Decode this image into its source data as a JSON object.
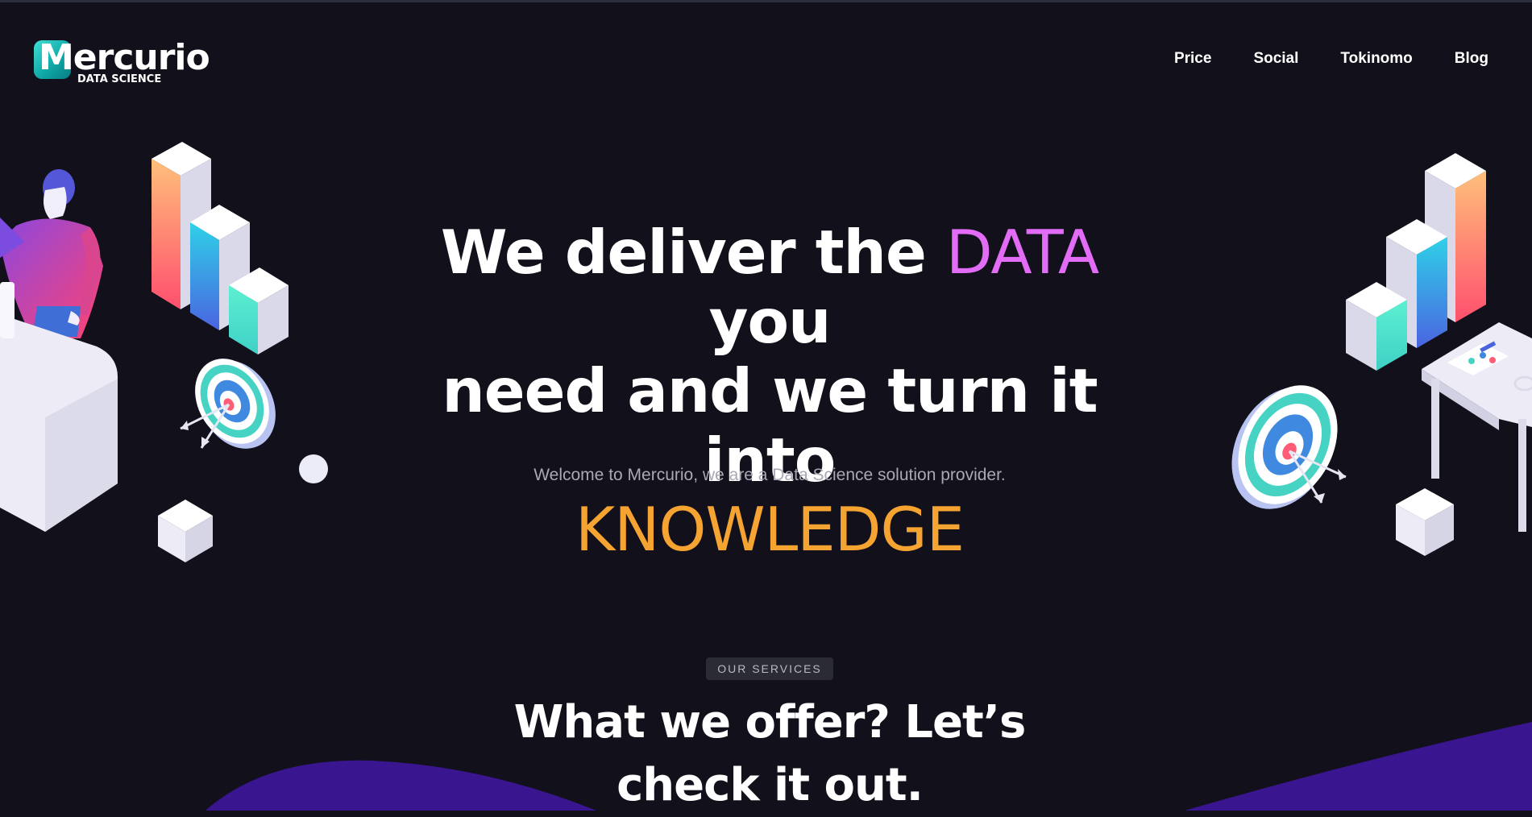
{
  "header": {
    "logo_word": "Mercurio",
    "logo_sub": "DATA SCIENCE",
    "nav": [
      "Price",
      "Social",
      "Tokinomo",
      "Blog"
    ]
  },
  "hero": {
    "line1_pre": "We deliver the ",
    "line1_highlight": "DATA",
    "line1_post": " you",
    "line2": "need and we turn it into",
    "line3_highlight": "KNOWLEDGE",
    "subtitle": "Welcome to Mercurio, we are a Data Science solution provider."
  },
  "services": {
    "badge": "OUR SERVICES",
    "title_line1": "What we offer? Let’s",
    "title_line2": "check it out."
  },
  "colors": {
    "background": "#12101a",
    "accent_pink": "#e36cf6",
    "accent_orange": "#f5a331",
    "wave_purple": "#3a1590",
    "logo_teal": "#17b9b3"
  }
}
